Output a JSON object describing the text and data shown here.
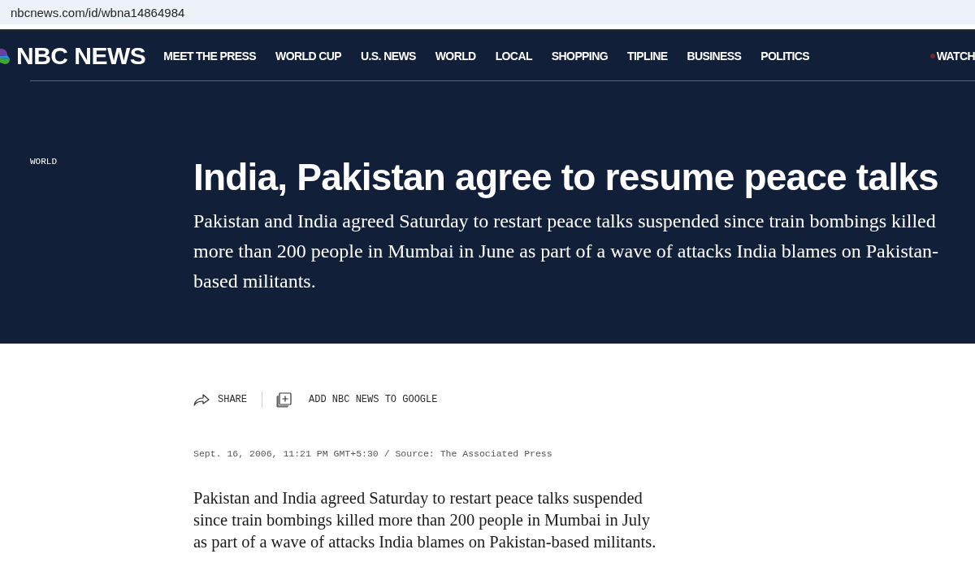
{
  "browser": {
    "url": "nbcnews.com/id/wbna14864984"
  },
  "header": {
    "logo_text": "NBC NEWS",
    "nav_items": [
      {
        "label": "MEET THE PRESS"
      },
      {
        "label": "WORLD CUP"
      },
      {
        "label": "U.S. NEWS"
      },
      {
        "label": "WORLD"
      },
      {
        "label": "LOCAL"
      },
      {
        "label": "SHOPPING"
      },
      {
        "label": "TIPLINE"
      },
      {
        "label": "BUSINESS"
      },
      {
        "label": "POLITICS"
      }
    ],
    "watch": {
      "label": "WATCH"
    }
  },
  "article": {
    "section": "WORLD",
    "headline": "India, Pakistan agree to resume peace talks",
    "dek": "Pakistan and India agreed Saturday to restart peace talks suspended since train bombings killed more than 200 people in Mumbai in June as part of a wave of attacks India blames on Pakistan-based militants.",
    "actions": [
      {
        "kind": "share",
        "label": "SHARE"
      },
      {
        "kind": "add_source",
        "label": "ADD NBC NEWS TO GOOGLE"
      }
    ],
    "byline": "Sept. 16, 2006, 11:21 PM GMT+5:30 / Source: The Associated Press",
    "body": [
      "Pakistan and India agreed Saturday to restart peace talks suspended since train bombings killed more than 200 people in Mumbai in July as part of a wave of attacks India blames on Pakistan-based militants."
    ]
  }
}
